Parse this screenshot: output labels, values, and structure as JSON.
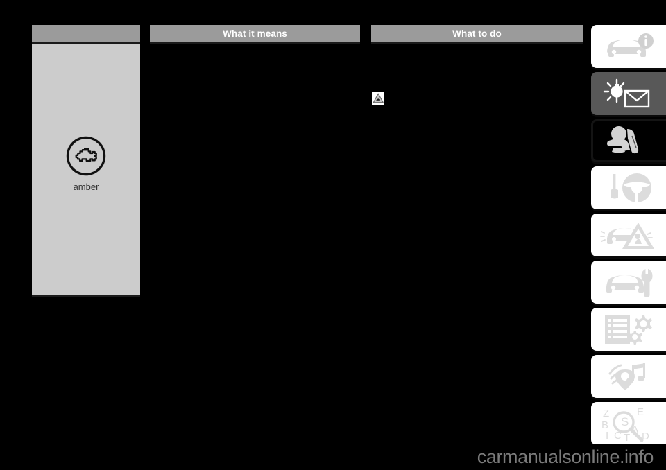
{
  "page": {
    "background_color": "#000000",
    "watermark": "carmanualsonline.info"
  },
  "table": {
    "headers": [
      {
        "id": "symbol",
        "label": ""
      },
      {
        "id": "what_it_means",
        "label": "What it means"
      },
      {
        "id": "what_to_do",
        "label": "What to do"
      }
    ],
    "header_background": "#9b9b9b",
    "header_text_color": "#ffffff",
    "symbol_cell": {
      "background": "#cccccc",
      "icon_name": "engine-check-icon",
      "caption": "amber",
      "caption_color": "#333333"
    },
    "what_it_means_cell": {
      "text": ""
    },
    "what_to_do_cell": {
      "text": "",
      "inline_icon_name": "warning-triangle-icon"
    }
  },
  "sidebar": {
    "tabs": [
      {
        "id": "tab-at-a-glance",
        "icon": "car-info-icon",
        "state": "light",
        "label": ""
      },
      {
        "id": "tab-warning-lights",
        "icon": "bulb-envelope-icon",
        "state": "active",
        "label": ""
      },
      {
        "id": "tab-safety",
        "icon": "child-seat-icon",
        "state": "dark",
        "label": ""
      },
      {
        "id": "tab-driving",
        "icon": "key-steering-wheel-icon",
        "state": "light",
        "label": ""
      },
      {
        "id": "tab-emergency",
        "icon": "car-hazard-triangle-icon",
        "state": "light",
        "label": ""
      },
      {
        "id": "tab-maintenance",
        "icon": "car-wrench-icon",
        "state": "light",
        "label": ""
      },
      {
        "id": "tab-specifications",
        "icon": "list-gears-icon",
        "state": "light",
        "label": ""
      },
      {
        "id": "tab-multimedia",
        "icon": "music-signal-icon",
        "state": "light",
        "label": ""
      },
      {
        "id": "tab-index",
        "icon": "alphabet-magnifier-icon",
        "state": "light",
        "label": ""
      }
    ]
  }
}
